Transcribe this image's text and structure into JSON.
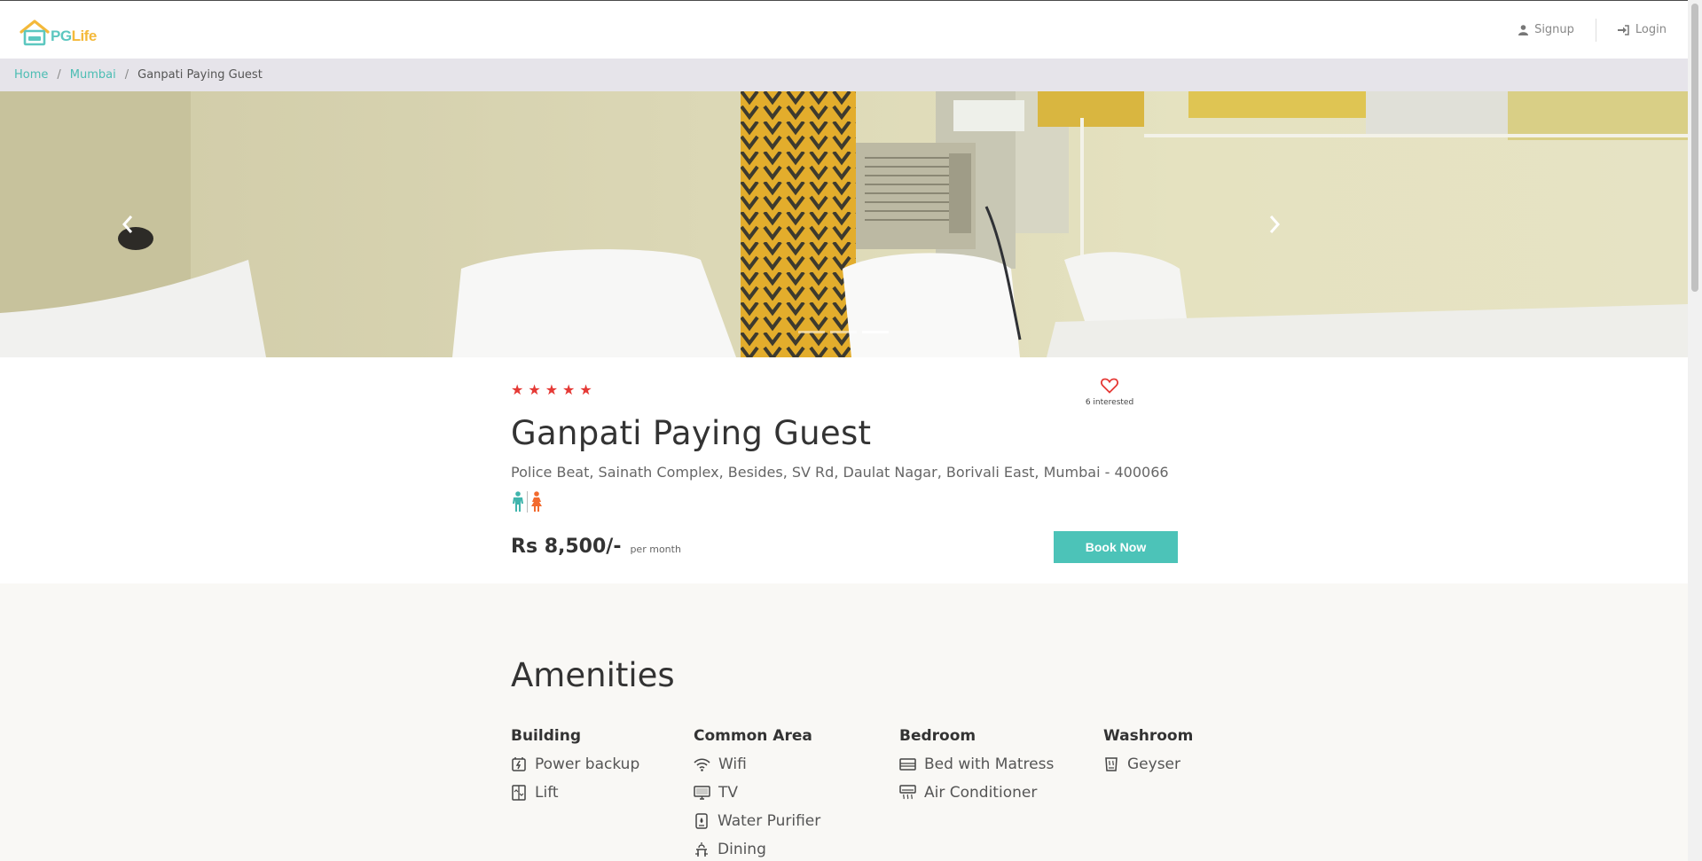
{
  "header": {
    "logo_pg": "PG",
    "logo_life": "Life",
    "signup_label": "Signup",
    "login_label": "Login"
  },
  "breadcrumb": {
    "items": [
      "Home",
      "Mumbai"
    ],
    "current": "Ganpati Paying Guest"
  },
  "carousel": {
    "slide_count": 3,
    "active_index": 2
  },
  "property": {
    "rating": 5,
    "interested_text": "6 interested",
    "name": "Ganpati Paying Guest",
    "address": "Police Beat, Sainath Complex, Besides, SV Rd, Daulat Nagar, Borivali East, Mumbai - 400066",
    "gender_icons": [
      "male-icon",
      "female-icon"
    ],
    "rent": "Rs 8,500/-",
    "rent_unit": "per month",
    "book_label": "Book Now"
  },
  "amenities": {
    "title": "Amenities",
    "groups": [
      {
        "heading": "Building",
        "items": [
          {
            "label": "Power backup",
            "icon": "power-backup-icon"
          },
          {
            "label": "Lift",
            "icon": "lift-icon"
          }
        ]
      },
      {
        "heading": "Common Area",
        "items": [
          {
            "label": "Wifi",
            "icon": "wifi-icon"
          },
          {
            "label": "TV",
            "icon": "tv-icon"
          },
          {
            "label": "Water Purifier",
            "icon": "water-purifier-icon"
          },
          {
            "label": "Dining",
            "icon": "dining-icon"
          }
        ]
      },
      {
        "heading": "Bedroom",
        "items": [
          {
            "label": "Bed with Matress",
            "icon": "bed-icon"
          },
          {
            "label": "Air Conditioner",
            "icon": "air-conditioner-icon"
          }
        ]
      },
      {
        "heading": "Washroom",
        "items": [
          {
            "label": "Geyser",
            "icon": "geyser-icon"
          }
        ]
      }
    ]
  },
  "colors": {
    "brand_teal": "#4cc3b8",
    "brand_yellow": "#f4b93a",
    "star_red": "#e53935",
    "female_orange": "#f26a2e"
  }
}
